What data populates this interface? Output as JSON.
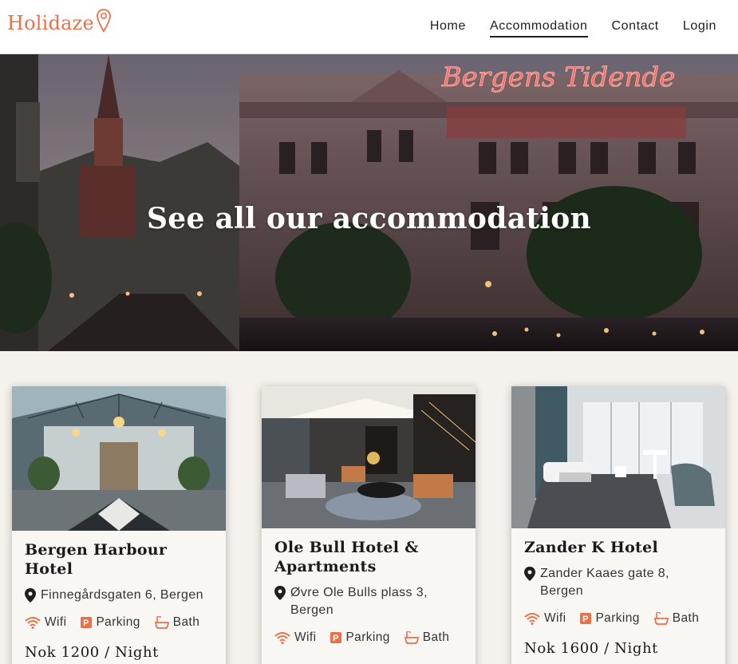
{
  "brand": {
    "name": "Holidaze",
    "accent": "#e8714a"
  },
  "nav": {
    "items": [
      {
        "label": "Home"
      },
      {
        "label": "Accommodation"
      },
      {
        "label": "Contact"
      },
      {
        "label": "Login"
      }
    ],
    "active": "Accommodation"
  },
  "hero": {
    "title": "See all our accommodation",
    "sign_text": "Bergens Tidende"
  },
  "cards": [
    {
      "title": "Bergen Harbour Hotel",
      "address": "Finnegårdsgaten 6, Bergen",
      "amenities": [
        "Wifi",
        "Parking",
        "Bath"
      ],
      "price": "Nok 1200 / Night"
    },
    {
      "title": "Ole Bull Hotel & Apartments",
      "address": "Øvre Ole Bulls plass 3, Bergen",
      "amenities": [
        "Wifi",
        "Parking",
        "Bath"
      ],
      "price": ""
    },
    {
      "title": "Zander K Hotel",
      "address": "Zander Kaaes gate 8, Bergen",
      "amenities": [
        "Wifi",
        "Parking",
        "Bath"
      ],
      "price": "Nok 1600 / Night"
    }
  ],
  "icons": {
    "pin": "map-pin-icon",
    "wifi": "wifi-icon",
    "parking": "parking-icon",
    "bath": "bath-icon"
  }
}
